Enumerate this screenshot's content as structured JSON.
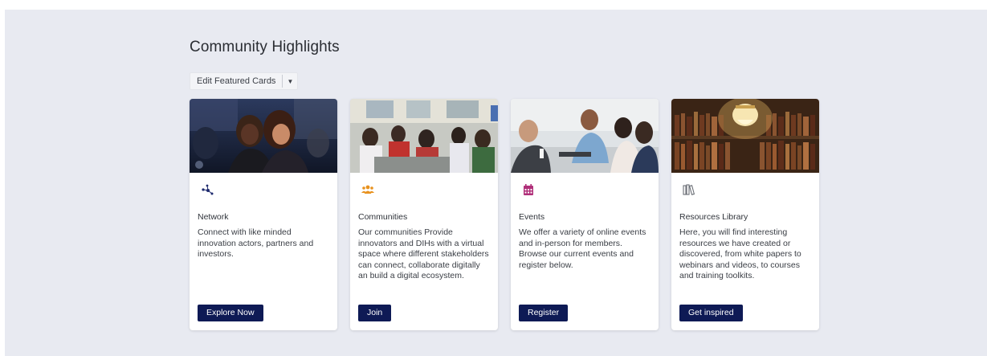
{
  "section": {
    "title": "Community Highlights",
    "edit_button": "Edit Featured Cards"
  },
  "cards": [
    {
      "icon": "network-icon",
      "icon_color": "#1e2a6e",
      "title": "Network",
      "description": "Connect with like minded innovation actors, partners and investors.",
      "button": "Explore Now"
    },
    {
      "icon": "users-icon",
      "icon_color": "#e8921f",
      "title": "Communities",
      "description": "Our communities Provide innovators and DIHs with a virtual space where different stakeholders can connect, collaborate digitally an build a digital ecosystem.",
      "button": "Join"
    },
    {
      "icon": "calendar-icon",
      "icon_color": "#b0307a",
      "title": "Events",
      "description": "We offer a variety of online events and in-person for members. Browse our current events and register below.",
      "button": "Register"
    },
    {
      "icon": "books-icon",
      "icon_color": "#6b6f76",
      "title": "Resources Library",
      "description": "Here, you will find interesting resources we have created or discovered, from white papers to webinars and videos, to courses and training toolkits.",
      "button": "Get inspired"
    }
  ],
  "colors": {
    "background": "#e8eaf1",
    "card": "#ffffff",
    "button": "#0e1a55"
  }
}
